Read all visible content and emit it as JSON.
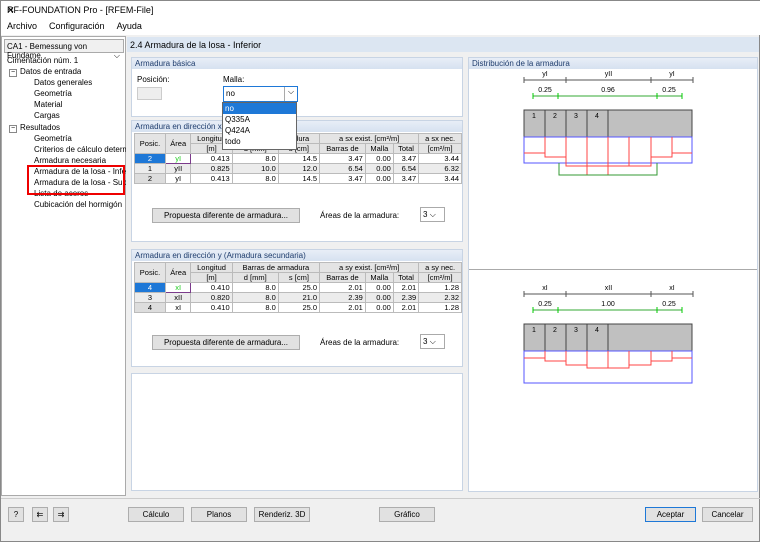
{
  "window": {
    "title": "RF-FOUNDATION Pro - [RFEM-File]",
    "close": "✕"
  },
  "menu": [
    "Archivo",
    "Configuración",
    "Ayuda"
  ],
  "sidebar": {
    "case": "CA1 - Bemessung von Fundame",
    "root": "Cimentación núm. 1",
    "input": {
      "label": "Datos de entrada",
      "items": [
        "Datos generales",
        "Geometría",
        "Material",
        "Cargas"
      ]
    },
    "results": {
      "label": "Resultados",
      "items": [
        "Geometría",
        "Criterios de cálculo determi",
        "Armadura necesaria",
        "Armadura de la losa - Infer",
        "Armadura de la losa - Supe",
        "Lista de aceros",
        "Cubicación del hormigón"
      ]
    }
  },
  "main": {
    "title": "2.4 Armadura de la losa - Inferior",
    "basic": {
      "title": "Armadura básica",
      "position_label": "Posición:",
      "mesh_label": "Malla:",
      "mesh_value": "no",
      "mesh_options": [
        "no",
        "Q335A",
        "Q424A",
        "todo"
      ]
    },
    "x_table": {
      "title": "Armadura en dirección x (Armadura principal)",
      "headers": {
        "pos": "Posic.",
        "area": "Área",
        "length": "Longitud",
        "length_unit": "[m]",
        "bars": "Barras de armadura",
        "d": "d [mm]",
        "s": "s [cm]",
        "exist": "a sx exist. [cm²/m]",
        "exist_bars": "Barras de",
        "exist_mesh": "Malla",
        "exist_total": "Total",
        "req": "a sx nec.",
        "req_unit": "[cm²/m]"
      },
      "rows": [
        [
          "2",
          "yI",
          "0.413",
          "8.0",
          "14.5",
          "3.47",
          "0.00",
          "3.47",
          "3.44"
        ],
        [
          "1",
          "yII",
          "0.825",
          "10.0",
          "12.0",
          "6.54",
          "0.00",
          "6.54",
          "6.32"
        ],
        [
          "2",
          "yI",
          "0.413",
          "8.0",
          "14.5",
          "3.47",
          "0.00",
          "3.47",
          "3.44"
        ]
      ],
      "propose": "Propuesta diferente de armadura...",
      "areas_label": "Áreas de la armadura:",
      "areas_value": "3"
    },
    "y_table": {
      "title": "Armadura en dirección y (Armadura secundaria)",
      "headers": {
        "pos": "Posic.",
        "area": "Área",
        "length": "Longitud",
        "length_unit": "[m]",
        "bars": "Barras de armadura",
        "d": "d [mm]",
        "s": "s [cm]",
        "exist": "a sy exist. [cm²/m]",
        "exist_bars": "Barras de",
        "exist_mesh": "Malla",
        "exist_total": "Total",
        "req": "a sy nec.",
        "req_unit": "[cm²/m]"
      },
      "rows": [
        [
          "4",
          "xI",
          "0.410",
          "8.0",
          "25.0",
          "2.01",
          "0.00",
          "2.01",
          "1.28"
        ],
        [
          "3",
          "xII",
          "0.820",
          "8.0",
          "21.0",
          "2.39",
          "0.00",
          "2.39",
          "2.32"
        ],
        [
          "4",
          "xI",
          "0.410",
          "8.0",
          "25.0",
          "2.01",
          "0.00",
          "2.01",
          "1.28"
        ]
      ],
      "propose": "Propuesta diferente de armadura...",
      "areas_label": "Áreas de la armadura:",
      "areas_value": "3"
    }
  },
  "graphic": {
    "title": "Distribución de la armadura",
    "top": {
      "zones": [
        "yI",
        "yII",
        "yI"
      ],
      "dims": [
        "0.25",
        "0.96",
        "0.25"
      ],
      "cells": [
        "1",
        "2",
        "3",
        "4"
      ]
    },
    "bottom": {
      "zones": [
        "xI",
        "xII",
        "xI"
      ],
      "dims": [
        "0.25",
        "1.00",
        "0.25"
      ],
      "cells": [
        "1",
        "2",
        "3",
        "4"
      ]
    }
  },
  "buttons": {
    "calc": "Cálculo",
    "plans": "Planos",
    "render": "Renderiz. 3D",
    "graphic": "Gráfico",
    "ok": "Aceptar",
    "cancel": "Cancelar"
  }
}
